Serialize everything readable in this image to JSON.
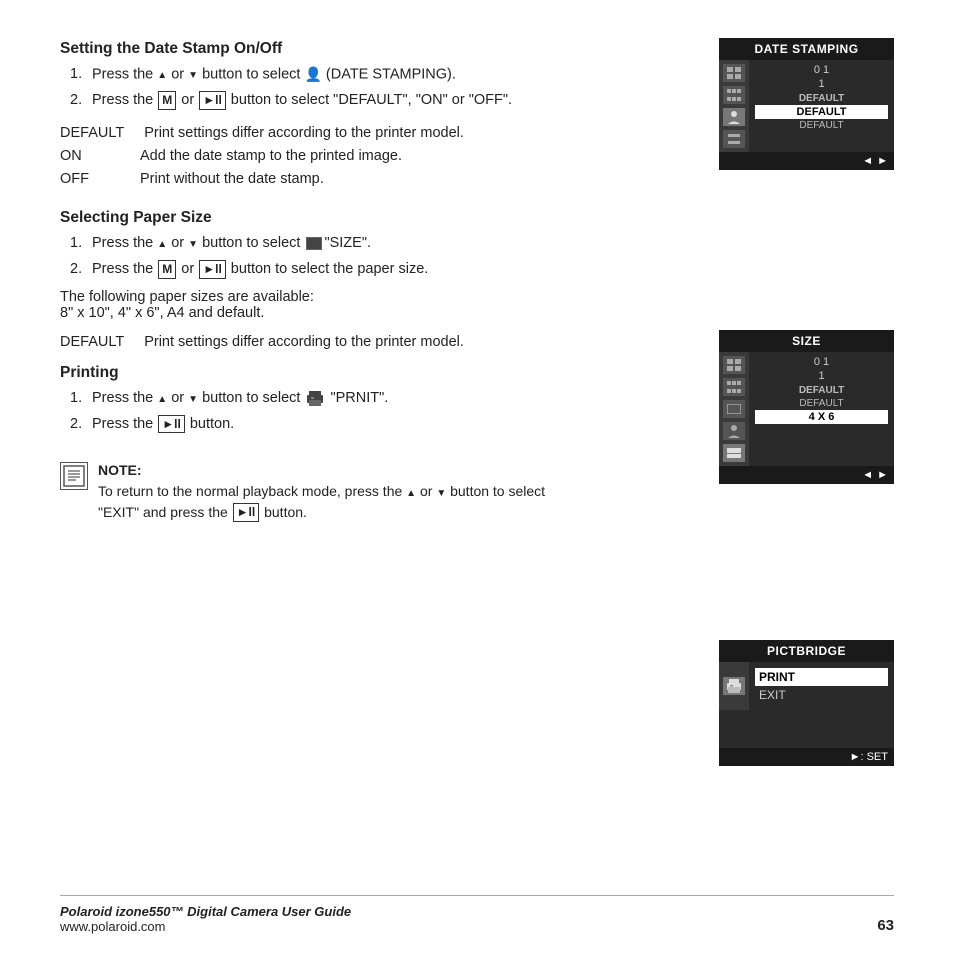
{
  "date_stamping_section": {
    "heading": "Setting the Date Stamp On/Off",
    "steps": [
      {
        "num": "1.",
        "text_parts": [
          "Press the ",
          "▲",
          " or ",
          "▼",
          " button to select ",
          "🔒",
          " (DATE STAMPING)."
        ]
      },
      {
        "num": "2.",
        "text_parts": [
          "Press the ",
          "M",
          " or ",
          "►ll",
          " button to select \"DEFAULT\", \"ON\" or \"OFF\"."
        ]
      }
    ],
    "defs": [
      {
        "term": "DEFAULT",
        "desc": "Print settings differ according to the printer model."
      },
      {
        "term": "ON",
        "desc": "Add the date stamp to the printed image."
      },
      {
        "term": "OFF",
        "desc": "Print without the date stamp."
      }
    ]
  },
  "date_panel": {
    "header": "DATE STAMPING",
    "nums": "0 1",
    "num2": "1",
    "items": [
      "DEFAULT",
      "DEFAULT",
      "DEFAULT"
    ],
    "selected_index": 1,
    "footer_left": "◄",
    "footer_right": "►"
  },
  "size_section": {
    "heading": "Selecting Paper Size",
    "steps": [
      {
        "num": "1.",
        "text": "Press the ▲ or ▼ button to select 🗂 \"SIZE\"."
      },
      {
        "num": "2.",
        "text": "Press the M or ►ll button to select the paper size."
      }
    ],
    "note": "The following paper sizes are available:",
    "note2": "8\" x 10\", 4\" x 6\", A4 and default.",
    "def_label": "DEFAULT",
    "def_desc": "Print settings differ according to the printer model."
  },
  "size_panel": {
    "header": "SIZE",
    "nums": "0 1",
    "num2": "1",
    "items": [
      "DEFAULT",
      "DEFAULT",
      "4 X 6"
    ],
    "selected_index": 2,
    "footer_left": "◄",
    "footer_right": "►"
  },
  "printing_section": {
    "heading": "Printing",
    "steps": [
      {
        "num": "1.",
        "text": "Press the ▲ or ▼ button to select 🖨 \"PRNIT\"."
      },
      {
        "num": "2.",
        "text": "Press the ►ll button."
      }
    ]
  },
  "pict_panel": {
    "header": "PICTBRIDGE",
    "items": [
      "PRINT",
      "EXIT"
    ],
    "selected_index": 0,
    "footer_text": "►:  SET"
  },
  "note_section": {
    "title": "NOTE:",
    "text": "To return to the normal playback mode, press the ▲ or ▼ button to select \"EXIT\" and press the ►ll button."
  },
  "footer": {
    "brand_italic": "Polaroid izone550™ Digital Camera User Guide",
    "website": "www.polaroid.com",
    "page_number": "63"
  }
}
